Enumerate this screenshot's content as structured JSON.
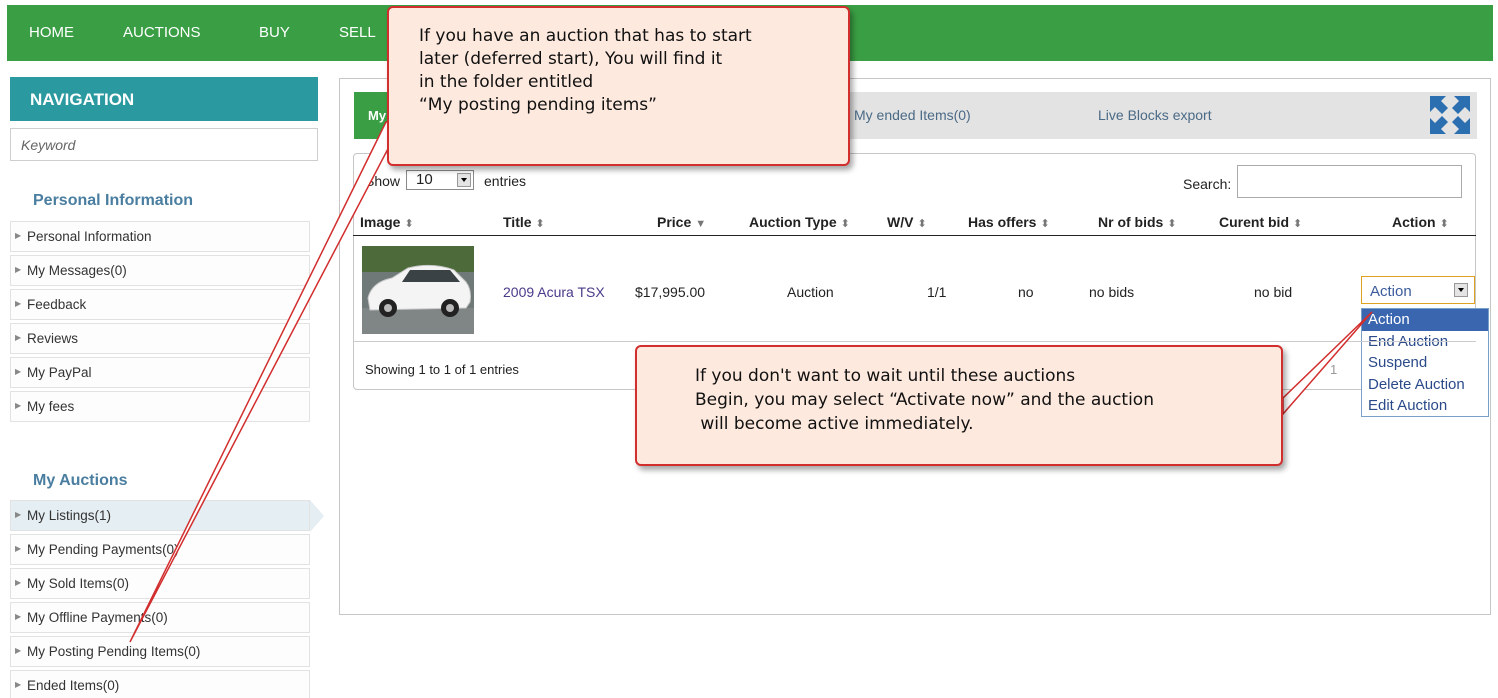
{
  "topnav": {
    "items": [
      "HOME",
      "AUCTIONS",
      "BUY",
      "SELL"
    ]
  },
  "sidebar": {
    "nav_title": "NAVIGATION",
    "keyword_placeholder": "Keyword",
    "personal_title": "Personal Information",
    "personal_items": [
      "Personal Information",
      "My Messages(0)",
      "Feedback",
      "Reviews",
      "My PayPal",
      "My fees"
    ],
    "auctions_title": "My Auctions",
    "auction_items": [
      "My Listings(1)",
      "My Pending Payments(0)",
      "My Sold Items(0)",
      "My Offline Payments(0)",
      "My Posting Pending Items(0)",
      "Ended Items(0)"
    ],
    "active_item": "My Listings(1)"
  },
  "tabs": {
    "active_label": "My",
    "ended": "My ended Items(0)",
    "export": "Live Blocks export"
  },
  "table_controls": {
    "show_label": "Show",
    "page_size": "10",
    "entries_label": "entries",
    "search_label": "Search:",
    "search_value": ""
  },
  "table": {
    "headers": [
      "Image",
      "Title",
      "Price",
      "Auction Type",
      "W/V",
      "Has offers",
      "Nr of bids",
      "Curent bid",
      "Action"
    ],
    "row": {
      "title": "2009 Acura TSX",
      "price": "$17,995.00",
      "auction_type": "Auction",
      "wv": "1/1",
      "has_offers": "no",
      "nr_of_bids": "no bids",
      "current_bid": "no bid",
      "action_selected": "Action",
      "action_options": [
        "Action",
        "End Auction",
        "Suspend",
        "Delete Auction",
        "Edit Auction"
      ]
    },
    "showing": "Showing 1 to 1 of 1 entries",
    "pager_visible": "1"
  },
  "callouts": {
    "top": [
      "If you have an auction that has to start",
      "later (deferred start), You will find it",
      "in the folder entitled",
      "“My posting pending items”"
    ],
    "bottom": [
      "If you don't want to wait until these auctions",
      "Begin, you may select “Activate now” and the auction",
      " will become active immediately."
    ]
  },
  "colors": {
    "nav_green": "#3a9f44",
    "nav_teal": "#2b9aa0",
    "callout_border": "#d22e2e",
    "callout_fill": "#fde9de"
  }
}
